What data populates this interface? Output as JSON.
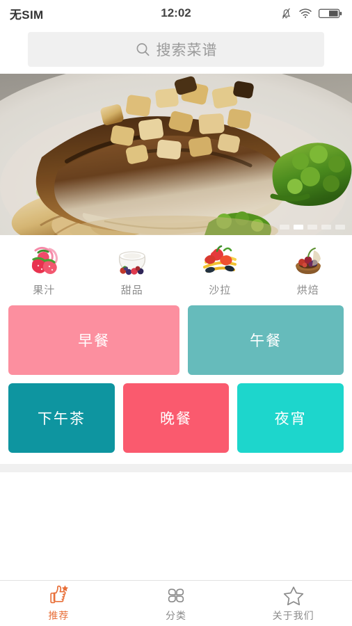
{
  "status_bar": {
    "carrier": "无SIM",
    "time": "12:02",
    "icons": [
      "mute-bell-icon",
      "wifi-icon",
      "battery-icon"
    ],
    "battery_percent": 50
  },
  "search": {
    "placeholder": "搜索菜谱",
    "icon": "search-icon",
    "value": ""
  },
  "hero": {
    "alt": "烤猪排配土豆与西兰花",
    "carousel": {
      "count": 5,
      "active_index": 1
    }
  },
  "categories": [
    {
      "label": "果汁",
      "icon": "strawberry-juice-icon"
    },
    {
      "label": "甜品",
      "icon": "dessert-bowl-icon"
    },
    {
      "label": "沙拉",
      "icon": "salad-icon"
    },
    {
      "label": "烘焙",
      "icon": "baking-tart-icon"
    }
  ],
  "meals": {
    "row1": [
      {
        "label": "早餐",
        "color": "#FC8F9F",
        "flex": 1.1
      },
      {
        "label": "午餐",
        "color": "#66BBBB",
        "flex": 1
      }
    ],
    "row2": [
      {
        "label": "下午茶",
        "color": "#0E95A0",
        "flex": 1
      },
      {
        "label": "晚餐",
        "color": "#FA5A6E",
        "flex": 1
      },
      {
        "label": "夜宵",
        "color": "#1DD6CC",
        "flex": 1
      }
    ]
  },
  "tabbar": {
    "active_color": "#E8703A",
    "inactive_color": "#8A8A8A",
    "items": [
      {
        "label": "推荐",
        "icon": "thumbs-up-star-icon",
        "active": true
      },
      {
        "label": "分类",
        "icon": "four-petal-grid-icon",
        "active": false
      },
      {
        "label": "关于我们",
        "icon": "star-outline-icon",
        "active": false
      }
    ]
  }
}
